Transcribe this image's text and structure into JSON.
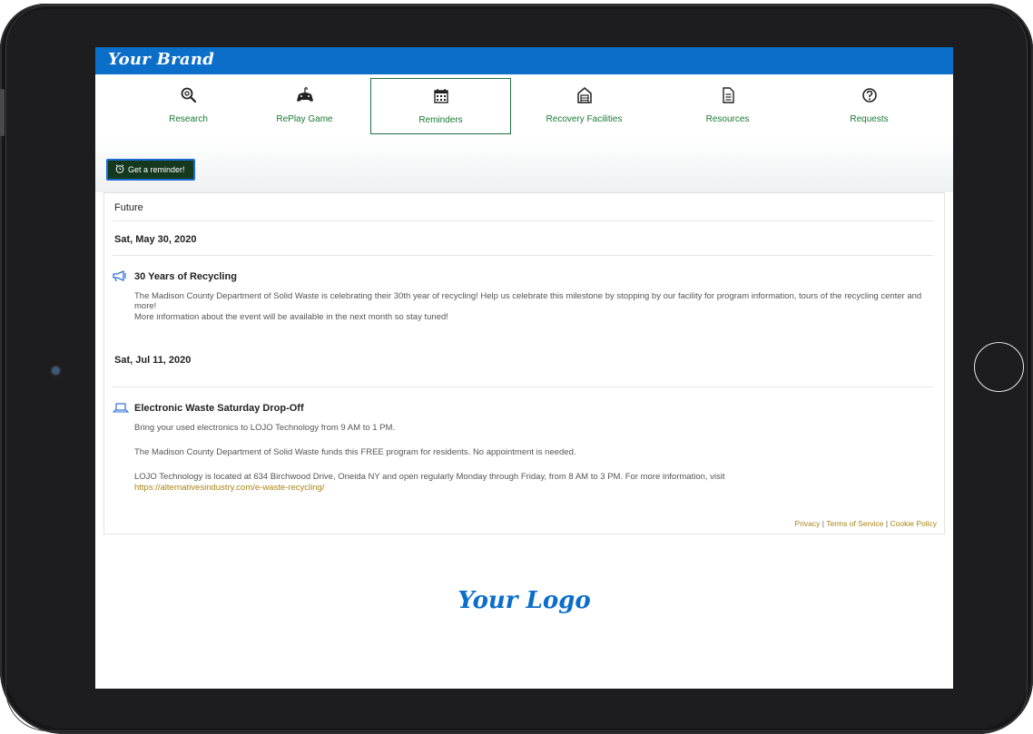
{
  "brand": {
    "name": "Your Brand",
    "color": "#0b6ec9"
  },
  "nav": {
    "items": [
      {
        "label": "Research",
        "icon": "magnifier-icon",
        "active": false
      },
      {
        "label": "RePlay Game",
        "icon": "game-controller-icon",
        "active": false
      },
      {
        "label": "Reminders",
        "icon": "calendar-icon",
        "active": true
      },
      {
        "label": "Recovery Facilities",
        "icon": "facility-icon",
        "active": false
      },
      {
        "label": "Resources",
        "icon": "document-icon",
        "active": false
      },
      {
        "label": "Requests",
        "icon": "question-icon",
        "active": false
      }
    ]
  },
  "actions": {
    "reminder_button": "Get a reminder!",
    "reminder_icon": "alarm-clock-icon"
  },
  "reminders": {
    "section_label": "Future",
    "groups": [
      {
        "date": "Sat, May 30, 2020",
        "event": {
          "icon": "megaphone-icon",
          "title": "30 Years of Recycling",
          "lines": [
            "The Madison County Department of Solid Waste is celebrating their 30th year of recycling! Help us celebrate this milestone by stopping by our facility for program information, tours of the recycling center and more!",
            "More information about the event will be available in the next month so stay tuned!"
          ]
        }
      },
      {
        "date": "Sat, Jul 11, 2020",
        "event": {
          "icon": "electronics-icon",
          "title": "Electronic Waste Saturday Drop-Off",
          "lines": [
            "Bring your used electronics to LOJO Technology from 9 AM to 1 PM.",
            "The Madison County Department of Solid Waste funds this FREE program for residents. No appointment is needed.",
            "LOJO Technology is located at 634 Birchwood Drive, Oneida NY and open regularly Monday through Friday, from 8 AM to 3 PM. For more information, visit"
          ],
          "link": "https://alternativesindustry.com/e-waste-recycling/"
        }
      }
    ]
  },
  "footer": {
    "privacy": "Privacy",
    "terms": "Terms of Service",
    "cookies": "Cookie Policy",
    "separator": "|"
  },
  "logo": {
    "text": "Your Logo"
  },
  "colors": {
    "nav_label": "#1a7a35",
    "button_bg": "#15391f",
    "link": "#a98417"
  }
}
